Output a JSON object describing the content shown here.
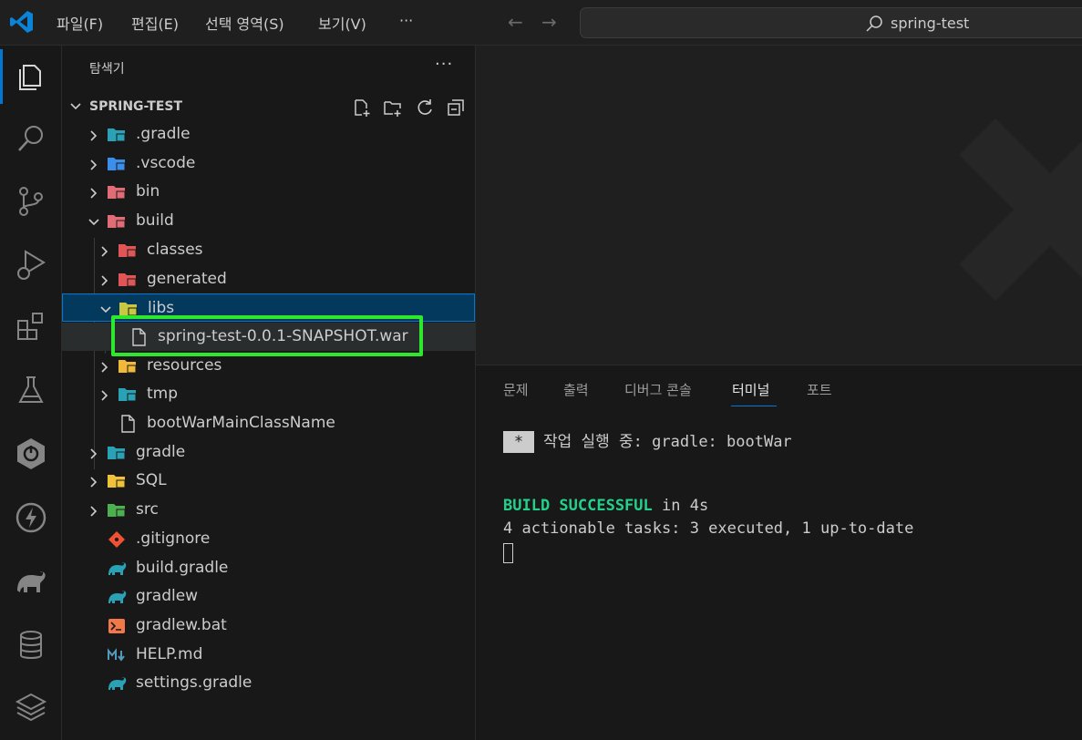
{
  "titlebar": {
    "menu": [
      "파일(F)",
      "편집(E)",
      "선택 영역(S)",
      "보기(V)",
      "···"
    ],
    "search_text": "spring-test"
  },
  "activitybar": {
    "items": [
      "explorer-icon",
      "search-icon",
      "source-control-icon",
      "run-debug-icon",
      "extensions-icon",
      "testing-icon",
      "spring-boot-icon",
      "thunder-client-icon",
      "gradle-icon",
      "database-icon",
      "layers-icon"
    ]
  },
  "sidebar": {
    "header": "탐색기",
    "more": "···",
    "section_title": "SPRING-TEST",
    "tree": [
      {
        "label": ".gradle",
        "type": "folder",
        "icon": "gradle-folder-icon"
      },
      {
        "label": ".vscode",
        "type": "folder",
        "icon": "vscode-folder-icon"
      },
      {
        "label": "bin",
        "type": "folder",
        "icon": "bin-folder-icon"
      },
      {
        "label": "build",
        "type": "folder-open",
        "icon": "build-folder-icon"
      },
      {
        "label": "classes",
        "type": "folder",
        "icon": "classes-folder-icon"
      },
      {
        "label": "generated",
        "type": "folder",
        "icon": "generated-folder-icon"
      },
      {
        "label": "libs",
        "type": "folder-open",
        "icon": "libs-folder-icon"
      },
      {
        "label": "spring-test-0.0.1-SNAPSHOT.war",
        "type": "file",
        "icon": "file-icon"
      },
      {
        "label": "resources",
        "type": "folder",
        "icon": "resources-folder-icon"
      },
      {
        "label": "tmp",
        "type": "folder",
        "icon": "tmp-folder-icon"
      },
      {
        "label": "bootWarMainClassName",
        "type": "file",
        "icon": "file-icon"
      },
      {
        "label": "gradle",
        "type": "folder",
        "icon": "gradle-folder-icon"
      },
      {
        "label": "SQL",
        "type": "folder",
        "icon": "sql-folder-icon"
      },
      {
        "label": "src",
        "type": "folder",
        "icon": "src-folder-icon"
      },
      {
        "label": ".gitignore",
        "type": "file",
        "icon": "git-icon"
      },
      {
        "label": "build.gradle",
        "type": "file",
        "icon": "gradle-file-icon"
      },
      {
        "label": "gradlew",
        "type": "file",
        "icon": "gradle-file-icon"
      },
      {
        "label": "gradlew.bat",
        "type": "file",
        "icon": "terminal-file-icon"
      },
      {
        "label": "HELP.md",
        "type": "file",
        "icon": "markdown-icon"
      },
      {
        "label": "settings.gradle",
        "type": "file",
        "icon": "gradle-file-icon"
      }
    ]
  },
  "panel": {
    "tabs": [
      "문제",
      "출력",
      "디버그 콘솔",
      "터미널",
      "포트"
    ],
    "active_tab": "터미널",
    "terminal": {
      "star": "*",
      "task_line": "작업 실행 중: gradle: bootWar",
      "build_success": "BUILD SUCCESSFUL",
      "build_time": " in 4s",
      "tasks_line": "4 actionable tasks: 3 executed, 1 up-to-date"
    }
  },
  "colors": {
    "accent": "#0078d4",
    "highlight": "#2ee82e",
    "success": "#23d18b"
  }
}
